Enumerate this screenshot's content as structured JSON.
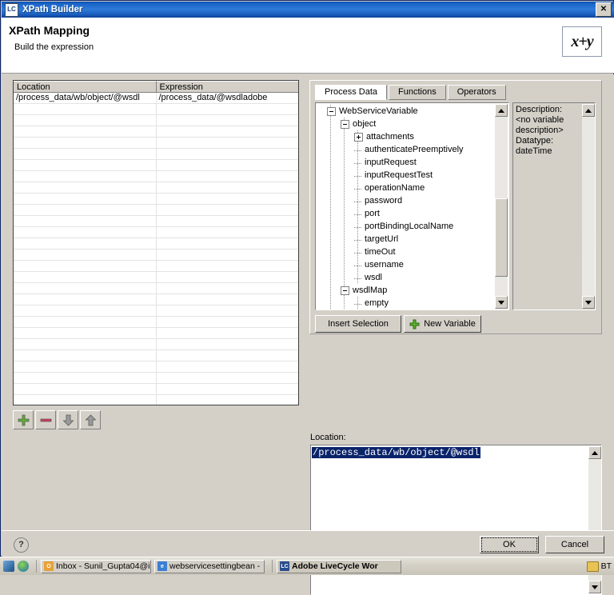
{
  "window": {
    "title": "XPath Builder",
    "icon_label": "LC",
    "close_label": "✕"
  },
  "header": {
    "title": "XPath Mapping",
    "subtitle": "Build the expression",
    "logo_text": "x+y"
  },
  "mapping_table": {
    "columns": [
      "Location",
      "Expression"
    ],
    "rows": [
      {
        "location": "/process_data/wb/object/@wsdl",
        "expression": "/process_data/@wsdladobe"
      }
    ],
    "empty_row_count": 27
  },
  "row_toolbar": {
    "buttons": [
      {
        "name": "add-row-button",
        "icon": "plus-icon",
        "color": "#5eb030"
      },
      {
        "name": "remove-row-button",
        "icon": "minus-icon",
        "color": "#d03a5a"
      },
      {
        "name": "move-down-button",
        "icon": "arrow-down-icon",
        "color": "#9a9a9a"
      },
      {
        "name": "move-up-button",
        "icon": "arrow-up-icon",
        "color": "#9a9a9a"
      }
    ]
  },
  "right_panel": {
    "tabs": [
      {
        "label": "Process Data",
        "selected": true
      },
      {
        "label": "Functions",
        "selected": false
      },
      {
        "label": "Operators",
        "selected": false
      }
    ],
    "tree": [
      {
        "label": "WebServiceVariable",
        "depth": 0,
        "toggle": "minus"
      },
      {
        "label": "object",
        "depth": 1,
        "toggle": "minus"
      },
      {
        "label": "attachments",
        "depth": 2,
        "toggle": "plus"
      },
      {
        "label": "authenticatePreemptively",
        "depth": 2,
        "toggle": "none"
      },
      {
        "label": "inputRequest",
        "depth": 2,
        "toggle": "none"
      },
      {
        "label": "inputRequestTest",
        "depth": 2,
        "toggle": "none"
      },
      {
        "label": "operationName",
        "depth": 2,
        "toggle": "none"
      },
      {
        "label": "password",
        "depth": 2,
        "toggle": "none"
      },
      {
        "label": "port",
        "depth": 2,
        "toggle": "none"
      },
      {
        "label": "portBindingLocalName",
        "depth": 2,
        "toggle": "none"
      },
      {
        "label": "targetUrl",
        "depth": 2,
        "toggle": "none"
      },
      {
        "label": "timeOut",
        "depth": 2,
        "toggle": "none"
      },
      {
        "label": "username",
        "depth": 2,
        "toggle": "none"
      },
      {
        "label": "wsdl",
        "depth": 2,
        "toggle": "none"
      },
      {
        "label": "wsdlMap",
        "depth": 1,
        "toggle": "minus"
      },
      {
        "label": "empty",
        "depth": 2,
        "toggle": "none"
      }
    ],
    "description": "Description:\n<no variable description>\nDatatype:\ndateTime",
    "insert_selection_label": "Insert Selection",
    "new_variable_label": "New Variable"
  },
  "location": {
    "label": "Location:",
    "value": "/process_data/wb/object/@wsdl",
    "selected": true
  },
  "footer": {
    "help_label": "?",
    "ok_label": "OK",
    "cancel_label": "Cancel"
  },
  "taskbar": {
    "items": [
      {
        "label": "Inbox - Sunil_Gupta04@i",
        "icon_color": "#e8a13a",
        "icon_text": "O",
        "active": false
      },
      {
        "label": "webservicesettingbean -",
        "icon_color": "#3b7fd4",
        "icon_text": "e",
        "active": false
      },
      {
        "label": "Adobe LiveCycle Wor",
        "icon_color": "#2a4d8f",
        "icon_text": "LC",
        "active": true
      }
    ],
    "tray_label": "BT"
  },
  "colors": {
    "title_bar": "#1862c6",
    "dialog_face": "#d4d0c8",
    "selection": "#0a246a",
    "accent_green": "#5eb030",
    "accent_red": "#d03a5a"
  }
}
